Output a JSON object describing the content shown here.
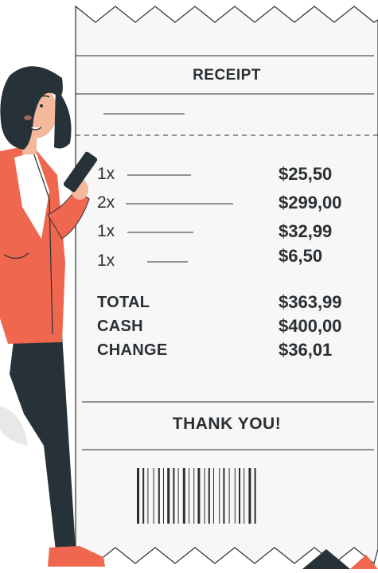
{
  "receipt": {
    "title": "RECEIPT",
    "items": [
      {
        "qty": "1x",
        "price": "$25,50"
      },
      {
        "qty": "2x",
        "price": "$299,00"
      },
      {
        "qty": "1x",
        "price": "$32,99"
      },
      {
        "qty": "1x",
        "price": "$6,50"
      }
    ],
    "summary": [
      {
        "label": "TOTAL",
        "value": "$363,99"
      },
      {
        "label": "CASH",
        "value": "$400,00"
      },
      {
        "label": "CHANGE",
        "value": "$36,01"
      }
    ],
    "footer": "THANK YOU!"
  },
  "colors": {
    "paper": "#f7f7f7",
    "ink": "#2a2f33",
    "jacket": "#f0674f",
    "pants": "#263238",
    "skin": "#f4b89a",
    "hair": "#263238"
  },
  "icons": [
    "barcode-icon",
    "phone-icon"
  ]
}
